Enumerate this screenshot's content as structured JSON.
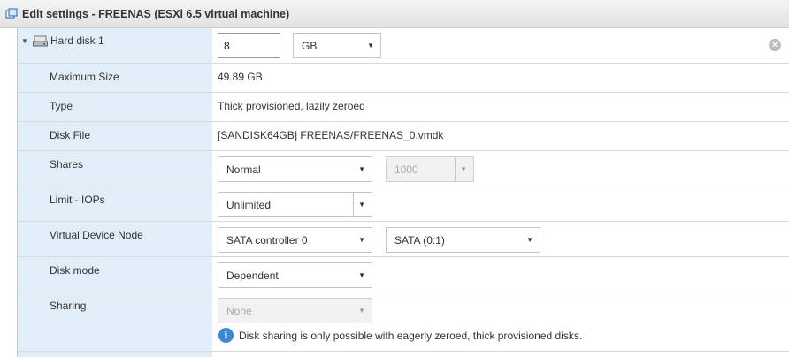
{
  "window": {
    "title": "Edit settings - FREENAS (ESXi 6.5 virtual machine)",
    "icon": "vm-settings-icon"
  },
  "hard_disk": {
    "label": "Hard disk 1",
    "size_value": "8",
    "size_unit": "GB"
  },
  "rows": {
    "max_size": {
      "label": "Maximum Size",
      "value": "49.89 GB"
    },
    "type": {
      "label": "Type",
      "value": "Thick provisioned, lazily zeroed"
    },
    "disk_file": {
      "label": "Disk File",
      "value": "[SANDISK64GB] FREENAS/FREENAS_0.vmdk"
    },
    "shares": {
      "label": "Shares",
      "level": "Normal",
      "value": "1000"
    },
    "limit_iops": {
      "label": "Limit - IOPs",
      "value": "Unlimited"
    },
    "vdn": {
      "label": "Virtual Device Node",
      "controller": "SATA controller 0",
      "port": "SATA (0:1)"
    },
    "disk_mode": {
      "label": "Disk mode",
      "value": "Dependent"
    },
    "sharing": {
      "label": "Sharing",
      "value": "None",
      "info": "Disk sharing is only possible with eagerly zeroed, thick provisioned disks."
    }
  },
  "colors": {
    "label_column_bg": "#e1edf7",
    "info_icon": "#3b8ad9",
    "close_icon": "#bbbbbb"
  }
}
